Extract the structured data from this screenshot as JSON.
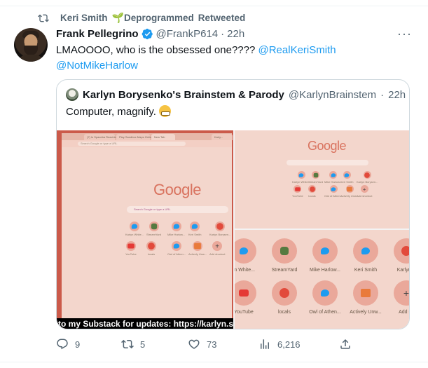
{
  "retweet": {
    "text": "Keri Smith",
    "badge": "Deprogrammed",
    "suffix": "Retweeted",
    "icon": "retweet-icon"
  },
  "tweet": {
    "author_name": "Frank Pellegrino",
    "author_handle": "@FrankP614",
    "separator": "·",
    "time": "22h",
    "text": "LMAOOOO, who is the obsessed one???? ",
    "mention1": "@RealKeriSmith",
    "mention2": "@NotMikeHarlow",
    "more": "···"
  },
  "quote": {
    "author_name": "Karlyn Borysenko's Brainstem & Parody",
    "author_handle": "@KarlynBrainstem",
    "separator": "·",
    "time": "22h",
    "text": "Computer, magnify.",
    "emoji": "grimacing-face"
  },
  "media": {
    "google": "Google",
    "search_placeholder": "Search Google or type a URL",
    "url_placeholder": "Search Google or type a URL",
    "tabs": [
      "(7) Is Spaceba Reaching Citiz...",
      "Play Sandbox Maps Online...",
      "New Tab",
      "Karly..."
    ],
    "shortcuts_small": [
      "Karlyn White...",
      "StreamYard",
      "Mike Harlow...",
      "Keri Smith",
      "Karlyn Borysen...",
      "YouTube",
      "locals",
      "Owl of Athen...",
      "Actively Unw...",
      "Add shortcut"
    ],
    "shortcuts_big_row1": [
      "rn White...",
      "StreamYard",
      "Mike Harlow...",
      "Keri Smith",
      "Karlyn B"
    ],
    "shortcuts_big_row2": [
      "YouTube",
      "locals",
      "Owl of Athen...",
      "Actively Unw...",
      "Add sh"
    ],
    "caption": "to my Substack for updates: https://karlyn.substa"
  },
  "actions": {
    "replies": "9",
    "retweets": "5",
    "likes": "73",
    "views": "6,216"
  },
  "colors": {
    "accent": "#1d9bf0",
    "muted": "#536471",
    "text": "#0f1419"
  }
}
